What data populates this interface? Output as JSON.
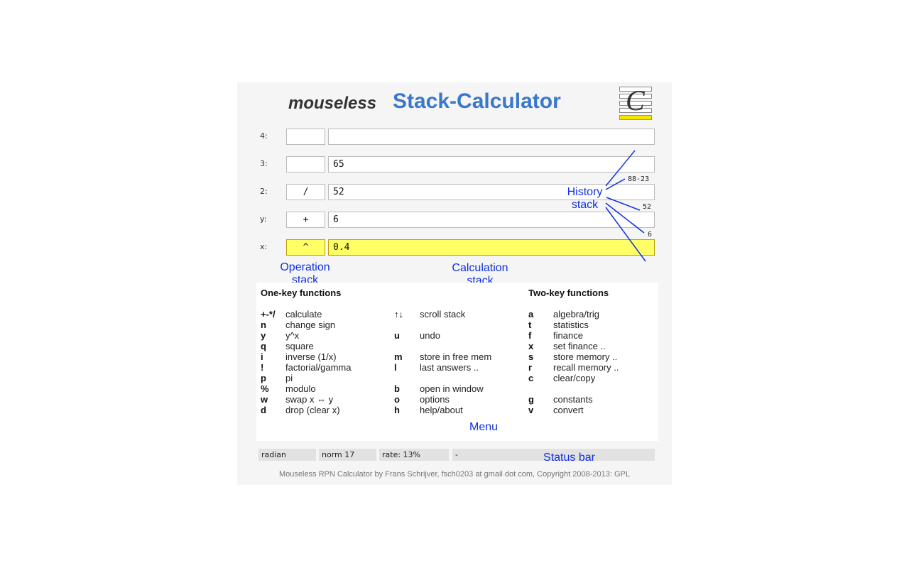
{
  "header": {
    "title_italic": "mouseless",
    "title_main": "Stack-Calculator",
    "logo_letter": "C"
  },
  "stack": [
    {
      "label": "4:",
      "op": "",
      "value": ""
    },
    {
      "label": "3:",
      "op": "",
      "value": "65"
    },
    {
      "label": "2:",
      "op": "/",
      "value": "52"
    },
    {
      "label": "y:",
      "op": "+",
      "value": "6"
    },
    {
      "label": "x:",
      "op": "^",
      "value": "0.4"
    }
  ],
  "history": [
    "88-23",
    "52",
    "6"
  ],
  "annotations": {
    "operation_stack": [
      "Operation",
      "stack"
    ],
    "calculation_stack": [
      "Calculation",
      "stack"
    ],
    "history_stack": [
      "History",
      "stack"
    ],
    "menu": "Menu",
    "status_bar": "Status bar"
  },
  "menu": {
    "one_key_title": "One-key functions",
    "two_key_title": "Two-key functions",
    "col1": [
      {
        "key": "+-*/",
        "desc": "calculate"
      },
      {
        "key": "n",
        "desc": "change sign"
      },
      {
        "key": "y",
        "desc": "y^x"
      },
      {
        "key": "q",
        "desc": "square"
      },
      {
        "key": "i",
        "desc": "inverse (1/x)"
      },
      {
        "key": "!",
        "desc": "factorial/gamma"
      },
      {
        "key": "p",
        "desc": "pi"
      },
      {
        "key": "%",
        "desc": "modulo"
      },
      {
        "key": "w",
        "desc": "swap x ⇔ y"
      },
      {
        "key": "d",
        "desc": "drop (clear x)"
      }
    ],
    "col2": [
      {
        "key": "↑↓",
        "desc": "scroll stack"
      },
      {
        "key": "",
        "desc": ""
      },
      {
        "key": "u",
        "desc": "undo"
      },
      {
        "key": "",
        "desc": ""
      },
      {
        "key": "m",
        "desc": "store in free mem"
      },
      {
        "key": "l",
        "desc": "last answers .."
      },
      {
        "key": "",
        "desc": ""
      },
      {
        "key": "b",
        "desc": "open in window"
      },
      {
        "key": "o",
        "desc": "options"
      },
      {
        "key": "h",
        "desc": "help/about"
      }
    ],
    "col3": [
      {
        "key": "a",
        "desc": "algebra/trig"
      },
      {
        "key": "t",
        "desc": "statistics"
      },
      {
        "key": "f",
        "desc": "finance"
      },
      {
        "key": "x",
        "desc": "set finance .."
      },
      {
        "key": "s",
        "desc": "store memory .."
      },
      {
        "key": "r",
        "desc": "recall memory .."
      },
      {
        "key": "c",
        "desc": "clear/copy"
      },
      {
        "key": "",
        "desc": ""
      },
      {
        "key": "g",
        "desc": "constants"
      },
      {
        "key": "v",
        "desc": "convert"
      }
    ]
  },
  "status": {
    "angle": "radian",
    "format": "norm 17",
    "rate": "rate: 13%",
    "message": "-"
  },
  "footer": "Mouseless RPN Calculator by Frans Schrijver, fsch0203 at gmail dot com, Copyright 2008-2013: GPL",
  "colors": {
    "accent": "#3a78c9",
    "x_highlight": "#ffff66",
    "annotation": "#1030e0"
  }
}
